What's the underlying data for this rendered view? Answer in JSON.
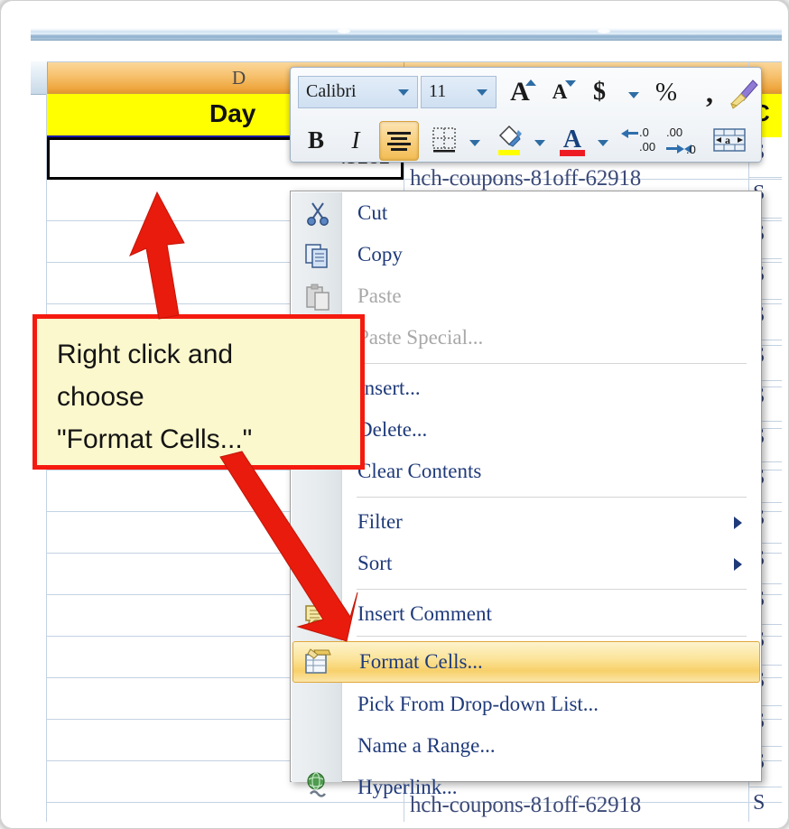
{
  "app": "Microsoft Excel 2010 worksheet with right-click context menu",
  "spreadsheet": {
    "column_header_letter": "D",
    "header_row_label": "Day",
    "header_row_fill": "#ffff00",
    "active_cell_value": "43282",
    "column_d_text_rows": [
      "hch-coupons-81off-62918",
      "hch-coupons-81off-62918"
    ],
    "right_column": {
      "header_label": "C",
      "cell_value": "S",
      "row_count": 16
    }
  },
  "mini_toolbar": {
    "font_name": "Calibri",
    "font_size": "11",
    "buttons": [
      {
        "name": "grow-font",
        "glyph": "A"
      },
      {
        "name": "shrink-font",
        "glyph": "A"
      },
      {
        "name": "accounting-number-format",
        "glyph": "$"
      },
      {
        "name": "percent-style",
        "glyph": "%"
      },
      {
        "name": "comma-style",
        "glyph": ","
      },
      {
        "name": "format-painter",
        "glyph": ""
      },
      {
        "name": "bold",
        "glyph": "B"
      },
      {
        "name": "italic",
        "glyph": "I"
      },
      {
        "name": "center-align",
        "glyph": ""
      },
      {
        "name": "borders",
        "glyph": ""
      },
      {
        "name": "fill-color",
        "glyph": ""
      },
      {
        "name": "font-color",
        "glyph": "A"
      },
      {
        "name": "increase-decimal",
        "glyph": ""
      },
      {
        "name": "decrease-decimal",
        "glyph": ""
      },
      {
        "name": "merge-and-center",
        "glyph": "a"
      }
    ]
  },
  "context_menu": {
    "items": [
      {
        "label": "Cut",
        "mnemonic": "t",
        "icon": "scissors-icon",
        "disabled": false,
        "selected": false,
        "submenu": false
      },
      {
        "label": "Copy",
        "mnemonic": "C",
        "icon": "copy-icon",
        "disabled": false,
        "selected": false,
        "submenu": false
      },
      {
        "label": "Paste",
        "mnemonic": "P",
        "icon": "paste-icon",
        "disabled": true,
        "selected": false,
        "submenu": false
      },
      {
        "label": "Paste Special...",
        "mnemonic": "S",
        "icon": "",
        "disabled": true,
        "selected": false,
        "submenu": false
      },
      {
        "label": "Insert...",
        "mnemonic": "I",
        "icon": "",
        "disabled": false,
        "selected": false,
        "submenu": false
      },
      {
        "label": "Delete...",
        "mnemonic": "D",
        "icon": "",
        "disabled": false,
        "selected": false,
        "submenu": false
      },
      {
        "label": "Clear Contents",
        "mnemonic": "n",
        "icon": "",
        "disabled": false,
        "selected": false,
        "submenu": false
      },
      {
        "label": "Filter",
        "mnemonic": "e",
        "icon": "",
        "disabled": false,
        "selected": false,
        "submenu": true
      },
      {
        "label": "Sort",
        "mnemonic": "o",
        "icon": "",
        "disabled": false,
        "selected": false,
        "submenu": true
      },
      {
        "label": "Insert Comment",
        "mnemonic": "m",
        "icon": "comment-icon",
        "disabled": false,
        "selected": false,
        "submenu": false
      },
      {
        "label": "Format Cells...",
        "mnemonic": "F",
        "icon": "format-cells-icon",
        "disabled": false,
        "selected": true,
        "submenu": false
      },
      {
        "label": "Pick From Drop-down List...",
        "mnemonic": "k",
        "icon": "",
        "disabled": false,
        "selected": false,
        "submenu": false
      },
      {
        "label": "Name a Range...",
        "mnemonic": "R",
        "icon": "",
        "disabled": false,
        "selected": false,
        "submenu": false
      },
      {
        "label": "Hyperlink...",
        "mnemonic": "H",
        "icon": "hyperlink-icon",
        "disabled": false,
        "selected": false,
        "submenu": false
      }
    ],
    "highlight_color": "#f8d06a"
  },
  "callout": {
    "line1": "Right click and",
    "line2": "choose",
    "line3": "\"Format Cells...\"",
    "fill": "#fbf8cd",
    "border": "#f51a0f"
  },
  "annotations": {
    "arrow_color": "#e81b0c",
    "arrow_to_cell": "points at active cell value 43282",
    "arrow_to_menu": "points at Format Cells... menu item"
  }
}
